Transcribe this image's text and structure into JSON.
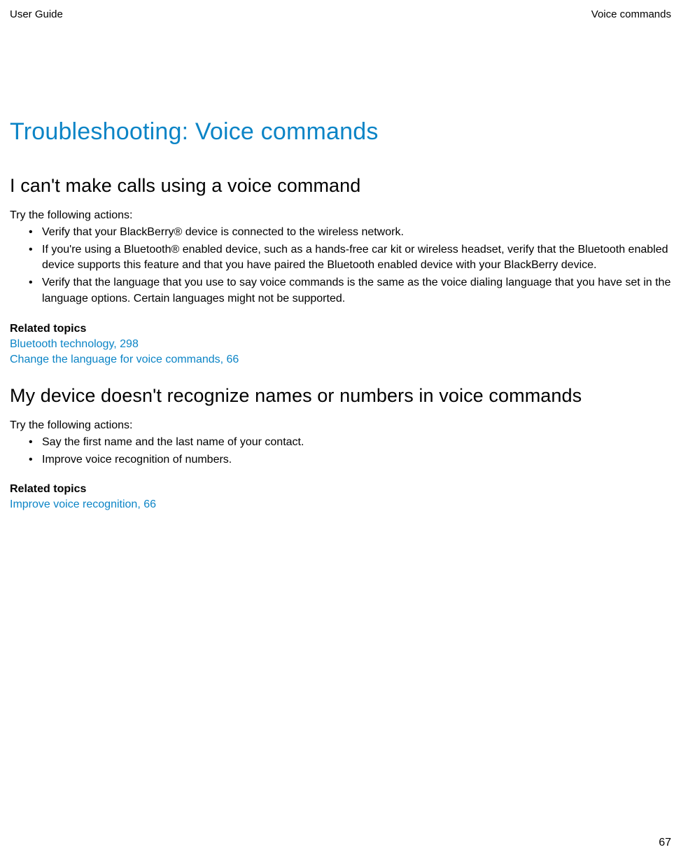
{
  "header": {
    "left": "User Guide",
    "right": "Voice commands"
  },
  "title": "Troubleshooting: Voice commands",
  "section1": {
    "heading": "I can't make calls using a voice command",
    "intro": "Try the following actions:",
    "bullets": [
      "Verify that your BlackBerry® device is connected to the wireless network.",
      "If you're using a Bluetooth® enabled device, such as a hands-free car kit or wireless headset, verify that the Bluetooth enabled device supports this feature and that you have paired the Bluetooth enabled device with your BlackBerry device.",
      "Verify that the language that you use to say voice commands is the same as the voice dialing language that you have set in the language options. Certain languages might not be supported."
    ],
    "related_heading": "Related topics",
    "links": [
      "Bluetooth technology, 298",
      "Change the language for voice commands, 66"
    ]
  },
  "section2": {
    "heading": "My device doesn't recognize names or numbers in voice commands",
    "intro": "Try the following actions:",
    "bullets": [
      "Say the first name and the last name of your contact.",
      "Improve voice recognition of numbers."
    ],
    "related_heading": "Related topics",
    "links": [
      "Improve voice recognition, 66"
    ]
  },
  "page_number": "67"
}
